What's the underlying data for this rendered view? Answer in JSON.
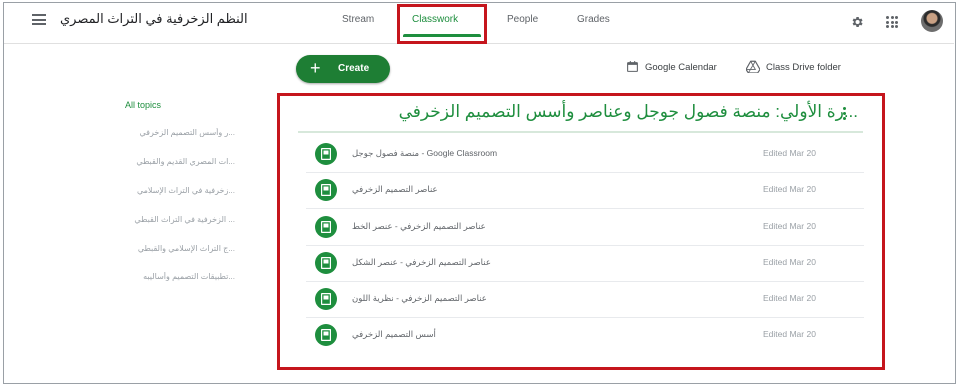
{
  "header": {
    "class_name": "النظم الزخرفية في التراث المصري",
    "tabs": [
      "Stream",
      "Classwork",
      "People",
      "Grades"
    ],
    "active_tab": "Classwork"
  },
  "toolbar": {
    "create_label": "Create",
    "calendar_label": "Google Calendar",
    "drive_label": "Class Drive folder"
  },
  "sidebar": {
    "all_topics": "All topics",
    "topics": [
      "...ر وأسس التصميم الزخرفي",
      "...ات المصري القديم والقبطي",
      "...زخرفية في التراث الإسلامي",
      "... الزخرفية في التراث القبطي",
      "...ج التراث الإسلامي والقبطي",
      "...تطبيقات التصميم وأساليبه"
    ]
  },
  "topic": {
    "title": "...رة الأولي: منصة فصول جوجل وعناصر وأسس التصميم الزخرفي",
    "items": [
      {
        "title": "Google Classroom - منصة فصول جوجل",
        "edited": "Edited Mar 20"
      },
      {
        "title": "عناصر التصميم الزخرفي",
        "edited": "Edited Mar 20"
      },
      {
        "title": "عناصر التصميم الزخرفي - عنصر الخط",
        "edited": "Edited Mar 20"
      },
      {
        "title": "عناصر التصميم الزخرفي - عنصر الشكل",
        "edited": "Edited Mar 20"
      },
      {
        "title": "عناصر التصميم الزخرفي - نظرية اللون",
        "edited": "Edited Mar 20"
      },
      {
        "title": "أسس التصميم الزخرفي",
        "edited": "Edited Mar 20"
      }
    ]
  },
  "colors": {
    "accent": "#1e8e3e",
    "highlight": "#c5161d"
  }
}
